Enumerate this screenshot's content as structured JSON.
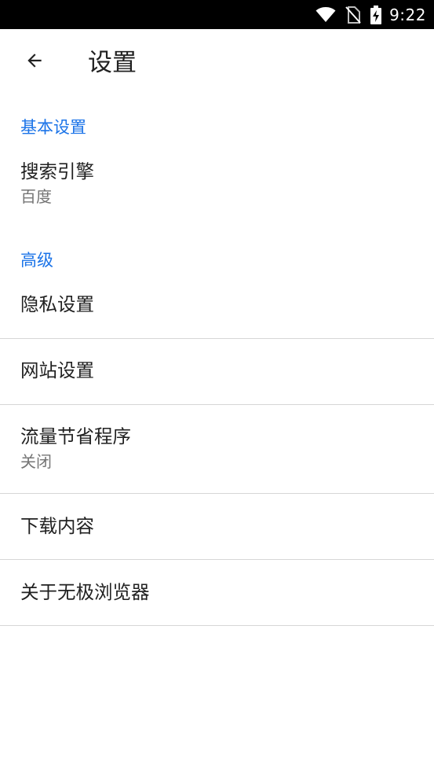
{
  "status_bar": {
    "time": "9:22",
    "icons": [
      "wifi-icon",
      "no-sim-icon",
      "battery-charging-icon"
    ]
  },
  "app_bar": {
    "back_icon": "arrow-back-icon",
    "title": "设置"
  },
  "sections": [
    {
      "header": "基本设置",
      "items": [
        {
          "title": "搜索引擎",
          "summary": "百度"
        }
      ]
    },
    {
      "header": "高级",
      "items": [
        {
          "title": "隐私设置"
        },
        {
          "title": "网站设置"
        },
        {
          "title": "流量节省程序",
          "summary": "关闭"
        },
        {
          "title": "下载内容"
        },
        {
          "title": "关于无极浏览器"
        }
      ]
    }
  ],
  "colors": {
    "accent": "#1a73e8",
    "title_text": "#212121",
    "summary_text": "#757575",
    "divider": "#d6d6d6",
    "status_bar_bg": "#000000"
  }
}
